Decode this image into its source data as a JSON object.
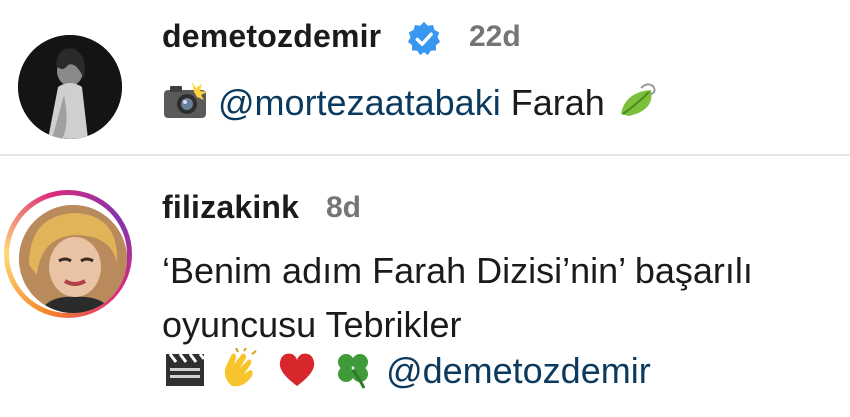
{
  "comments": [
    {
      "username": "demetozdemir",
      "verified": true,
      "timestamp": "22d",
      "avatar_icon": "profile-photo-bw",
      "body": {
        "emoji_before": "camera-flash-icon",
        "mention": "@mortezaatabaki",
        "text": "Farah",
        "emoji_after": "leaf-icon"
      }
    },
    {
      "username": "filizakink",
      "verified": false,
      "timestamp": "8d",
      "avatar_icon": "profile-photo-story-ring",
      "body": {
        "line1": "‘Benim adım Farah Dizisi’nin’  başarılı",
        "line2": "oyuncusu Tebrikler",
        "emojis": [
          "clapper-board-icon",
          "clapping-hands-icon",
          "red-heart-icon",
          "four-leaf-clover-icon"
        ],
        "mention": "@demetozdemir"
      }
    }
  ],
  "colors": {
    "mention": "#0b3a5e",
    "timestamp": "#757575",
    "verified": "#3897f0",
    "divider": "#e6e6e6"
  }
}
